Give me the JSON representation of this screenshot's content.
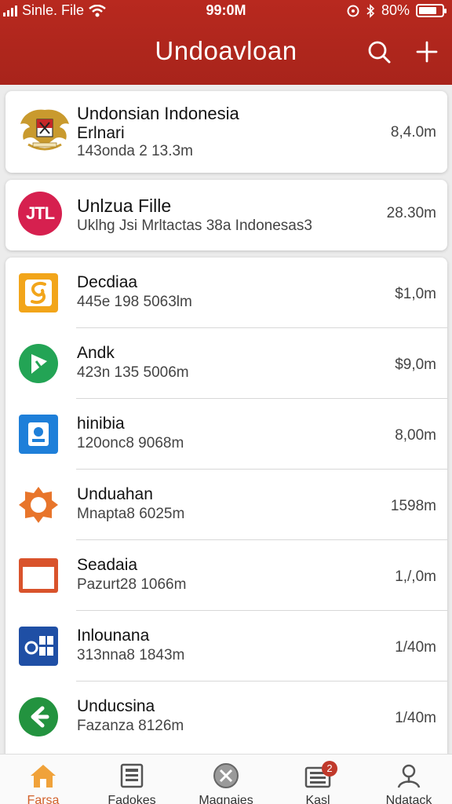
{
  "status": {
    "carrier": "Sinle. File",
    "time": "99:0M",
    "battery": "80%",
    "battery_level": 0.8
  },
  "header": {
    "title": "Undoavloan"
  },
  "featured": [
    {
      "title": "Undonsian  Indonesia",
      "subtitle": "Erlnari",
      "meta": "143onda 2 13.3m",
      "size": "8,4.0m",
      "icon": "indonesia-emblem-icon"
    },
    {
      "title": "Unlzua Fille",
      "meta": "Uklhg Jsi Mrltactas 38a Indonesas3",
      "size": "28.30m",
      "icon": "jtl-logo-icon",
      "icon_text": "JTL"
    }
  ],
  "apps": [
    {
      "name": "Decdiaa",
      "meta": "445e 198 5063lm",
      "size": "$1,0m",
      "icon": "yellow-swirl-icon",
      "color": "#f2a51a"
    },
    {
      "name": "Andk",
      "meta": "423n 135 5006m",
      "size": "$9,0m",
      "icon": "green-play-icon",
      "color": "#23a455"
    },
    {
      "name": "hinibia",
      "meta": "120onc8 9068m",
      "size": "8,00m",
      "icon": "blue-shield-icon",
      "color": "#1e7fd9"
    },
    {
      "name": "Unduahan",
      "meta": "Mnapta8 6025m",
      "size": "1598m",
      "icon": "orange-flower-icon",
      "color": "#e8752b"
    },
    {
      "name": "Seadaia",
      "meta": "Pazurt28 1066m",
      "size": "1,/,0m",
      "icon": "window-icon",
      "color": "#d9532c"
    },
    {
      "name": "Inlounana",
      "meta": "313nna8 1843m",
      "size": "1/40m",
      "icon": "office-icon",
      "color": "#1f4fa5"
    },
    {
      "name": "Unducsina",
      "meta": "Fazanza 8126m",
      "size": "1/40m",
      "icon": "green-arrow-icon",
      "color": "#23933f"
    }
  ],
  "nav": [
    {
      "label": "Farsa",
      "icon": "home-icon",
      "active": true
    },
    {
      "label": "Fadokes",
      "icon": "document-icon"
    },
    {
      "label": "Magnajes",
      "icon": "close-circle-icon"
    },
    {
      "label": "Kasl",
      "icon": "list-icon",
      "badge": "2"
    },
    {
      "label": "Ndatack",
      "icon": "person-icon"
    }
  ],
  "colors": {
    "header": "#b8291f",
    "accent": "#e8752b",
    "badge": "#c0392b"
  }
}
